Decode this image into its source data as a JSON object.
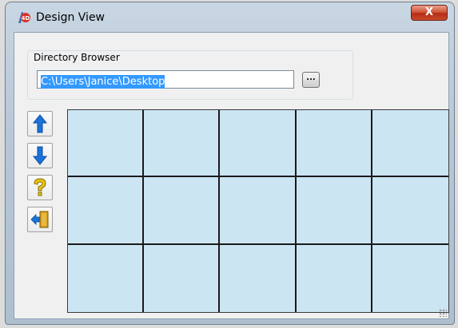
{
  "window": {
    "title": "Design View",
    "close_label": "X"
  },
  "directory_browser": {
    "label": "Directory Browser",
    "path": "C:\\Users\\Janice\\Desktop",
    "browse_label": "..."
  },
  "toolbar": {
    "buttons": [
      {
        "name": "up-arrow-icon",
        "color": "#1a73d9"
      },
      {
        "name": "down-arrow-icon",
        "color": "#1a73d9"
      },
      {
        "name": "help-question-icon",
        "color": "#e8c416"
      },
      {
        "name": "exit-door-icon",
        "color": "#d9a020"
      }
    ]
  },
  "grid": {
    "rows": 3,
    "columns": 5,
    "fill_color": "#cce5f3"
  }
}
